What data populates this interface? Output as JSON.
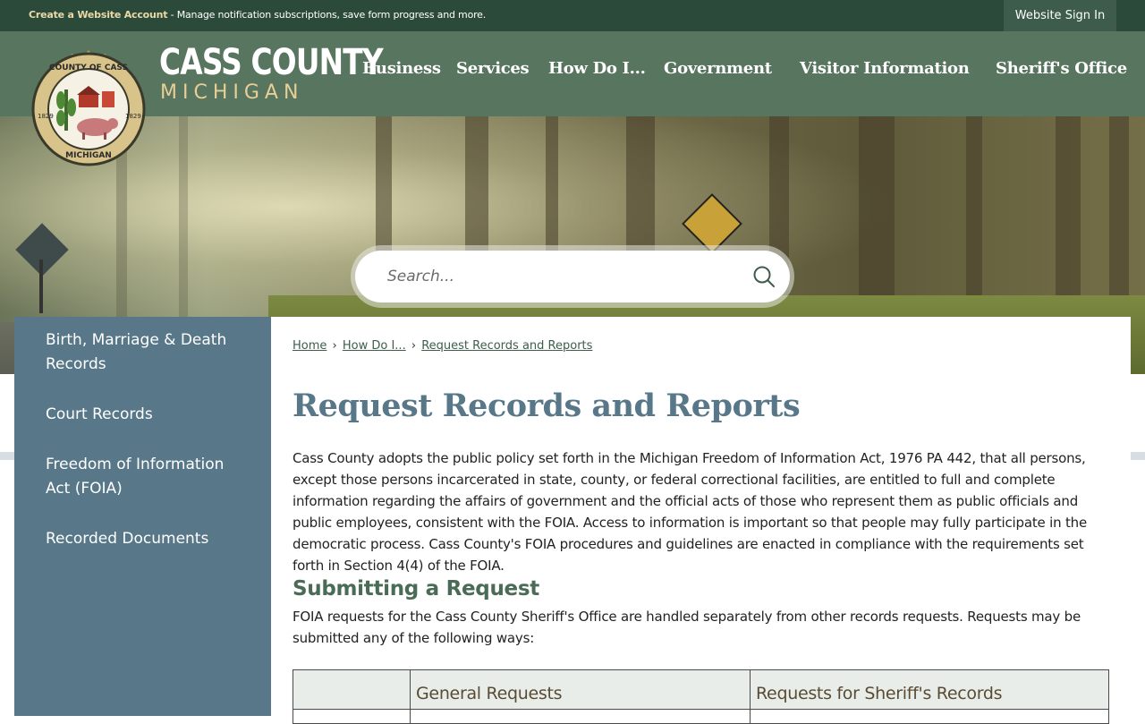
{
  "topbar": {
    "create_account_link": "Create a Website Account",
    "create_account_desc": " - Manage notification subscriptions, save form progress and more.",
    "sign_in": "Website Sign In"
  },
  "brand": {
    "title": "CASS COUNTY",
    "subtitle": "MICHIGAN",
    "seal_text_top": "COUNTY OF CASS",
    "seal_text_bottom": "MICHIGAN",
    "seal_year_left": "1829",
    "seal_year_right": "1829"
  },
  "nav": [
    {
      "label": "Business"
    },
    {
      "label": "Services"
    },
    {
      "label": "How Do I..."
    },
    {
      "label": "Government"
    },
    {
      "label": "Visitor Information"
    },
    {
      "label": "Sheriff's Office"
    }
  ],
  "search": {
    "placeholder": "Search...",
    "icon": "search-icon"
  },
  "sidebar": {
    "items": [
      {
        "label": "Birth, Marriage & Death Records"
      },
      {
        "label": "Court Records"
      },
      {
        "label": "Freedom of Information Act (FOIA)"
      },
      {
        "label": "Recorded Documents"
      }
    ]
  },
  "breadcrumb": {
    "items": [
      "Home",
      "How Do I...",
      "Request Records and Reports"
    ],
    "separator": "›"
  },
  "content": {
    "title": "Request Records and Reports",
    "intro": "Cass County adopts the public policy set forth in the Michigan Freedom of Information Act, 1976 PA 442, that all persons, except those persons incarcerated in state, county, or federal correctional facilities, are entitled to full and complete information regarding the affairs of government and the official acts of those who represent them as public officials and public employees, consistent with the FOIA.  Access to information is important so that people may fully participate in the democratic process. Cass County's FOIA procedures and guidelines are enacted in compliance with the requirements set forth in Section 4(4) of the FOIA.",
    "section_heading": "Submitting a Request",
    "section_text": "FOIA requests for the Cass County Sheriff's Office are handled separately from other records requests. Requests may be submitted any of the following ways:",
    "table": {
      "headers": [
        "",
        "General Requests",
        "Requests for Sheriff's Records"
      ]
    }
  },
  "colors": {
    "topbar": "#2c4a3a",
    "header": "#58755f",
    "sidebar": "#587889",
    "title": "#587889",
    "accent_gold": "#e7cf96"
  }
}
